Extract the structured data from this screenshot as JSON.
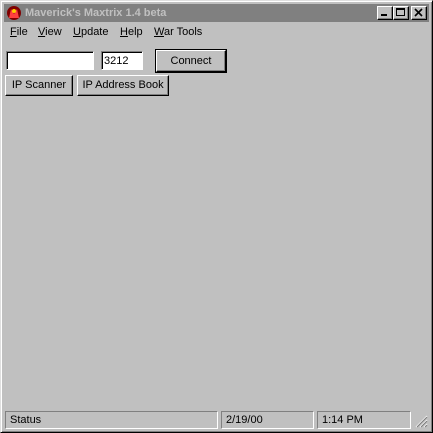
{
  "window": {
    "title": "Maverick's Maxtrix 1.4 beta",
    "icon": "app-logo-icon",
    "controls": [
      "minimize-icon",
      "maximize-icon",
      "close-icon"
    ]
  },
  "menu": {
    "items": [
      {
        "label": "File",
        "accel": "F",
        "rest": "ile"
      },
      {
        "label": "View",
        "accel": "V",
        "rest": "iew"
      },
      {
        "label": "Update",
        "accel": "U",
        "rest": "pdate"
      },
      {
        "label": "Help",
        "accel": "H",
        "rest": "elp"
      },
      {
        "label": "War Tools",
        "accel": "W",
        "rest": "ar Tools"
      }
    ]
  },
  "connection": {
    "host_value": "",
    "port_value": "3212",
    "connect_label": "Connect"
  },
  "tools": {
    "ip_scanner_label": "IP Scanner",
    "ip_address_book_label": "IP Address Book"
  },
  "status": {
    "text": "Status",
    "date": "2/19/00",
    "time": "1:14 PM"
  },
  "colors": {
    "face": "#c0c0c0",
    "inactive_title": "#808080",
    "inactive_title_text": "#c0c0c0"
  }
}
